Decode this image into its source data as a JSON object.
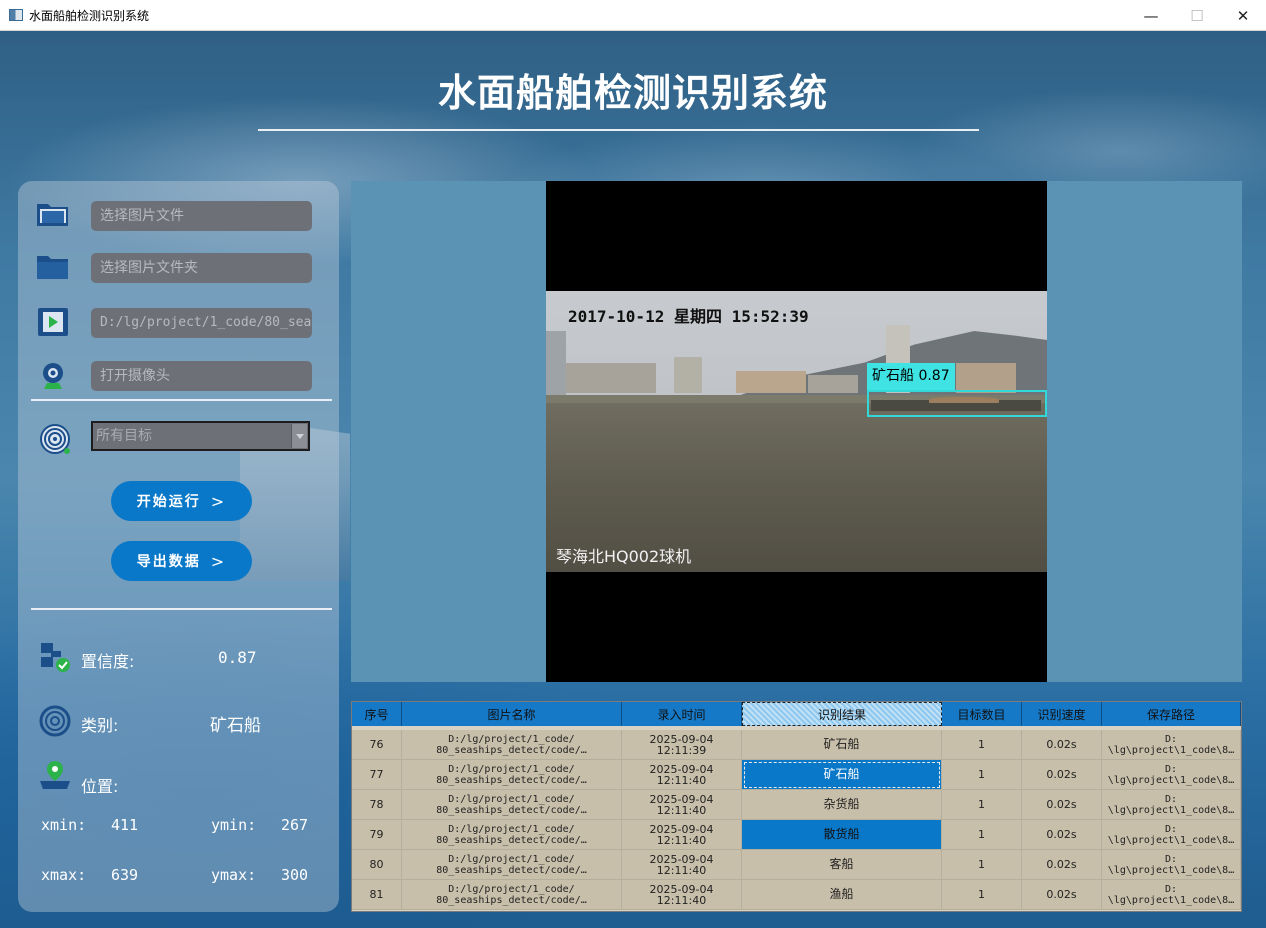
{
  "window": {
    "title": "水面船舶检测识别系统",
    "minimize": "—",
    "maximize": "☐",
    "close": "✕"
  },
  "header": {
    "title": "水面船舶检测识别系统"
  },
  "inputs": {
    "image_file": "选择图片文件",
    "image_folder": "选择图片文件夹",
    "video_file": "D:/lg/project/1_code/80_sea",
    "camera": "打开摄像头"
  },
  "target_select": {
    "selected": "所有目标"
  },
  "buttons": {
    "start": "开始运行",
    "export": "导出数据",
    "chevron": ">"
  },
  "info": {
    "confidence_label": "置信度:",
    "confidence_value": "0.87",
    "class_label": "类别:",
    "class_value": "矿石船",
    "position_label": "位置:",
    "xmin_label": "xmin:",
    "xmin": "411",
    "ymin_label": "ymin:",
    "ymin": "267",
    "xmax_label": "xmax:",
    "xmax": "639",
    "ymax_label": "ymax:",
    "ymax": "300"
  },
  "image": {
    "timestamp": "2017-10-12 星期四 15:52:39",
    "camera_name": "琴海北HQ002球机",
    "detection_label": "矿石船 0.87"
  },
  "table": {
    "headers": [
      "序号",
      "图片名称",
      "录入时间",
      "识别结果",
      "目标数目",
      "识别速度",
      "保存路径"
    ],
    "rows": [
      {
        "id": "76",
        "name": "D:/lg/project/1_code/\n80_seaships_detect/code/…",
        "time": "2025-09-04\n12:11:39",
        "result": "矿石船",
        "count": "1",
        "speed": "0.02s",
        "path": "D:\n\\lg\\project\\1_code\\8…"
      },
      {
        "id": "77",
        "name": "D:/lg/project/1_code/\n80_seaships_detect/code/…",
        "time": "2025-09-04\n12:11:40",
        "result": "矿石船",
        "count": "1",
        "speed": "0.02s",
        "path": "D:\n\\lg\\project\\1_code\\8…"
      },
      {
        "id": "78",
        "name": "D:/lg/project/1_code/\n80_seaships_detect/code/…",
        "time": "2025-09-04\n12:11:40",
        "result": "杂货船",
        "count": "1",
        "speed": "0.02s",
        "path": "D:\n\\lg\\project\\1_code\\8…"
      },
      {
        "id": "79",
        "name": "D:/lg/project/1_code/\n80_seaships_detect/code/…",
        "time": "2025-09-04\n12:11:40",
        "result": "散货船",
        "count": "1",
        "speed": "0.02s",
        "path": "D:\n\\lg\\project\\1_code\\8…"
      },
      {
        "id": "80",
        "name": "D:/lg/project/1_code/\n80_seaships_detect/code/…",
        "time": "2025-09-04\n12:11:40",
        "result": "客船",
        "count": "1",
        "speed": "0.02s",
        "path": "D:\n\\lg\\project\\1_code\\8…"
      },
      {
        "id": "81",
        "name": "D:/lg/project/1_code/\n80_seaships_detect/code/…",
        "time": "2025-09-04\n12:11:40",
        "result": "渔船",
        "count": "1",
        "speed": "0.02s",
        "path": "D:\n\\lg\\project\\1_code\\8…"
      }
    ]
  },
  "colors": {
    "accent": "#0a78c8",
    "field_bg": "#6e7078",
    "detect_box": "#30d8d8",
    "table_bg": "#c8bfaa"
  }
}
